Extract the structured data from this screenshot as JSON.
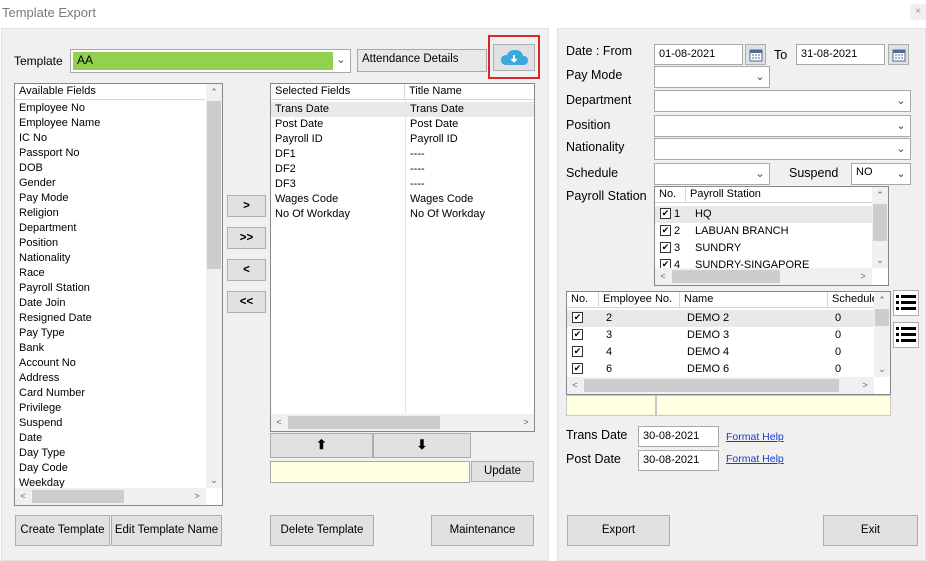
{
  "window": {
    "title": "Template Export",
    "close": "×"
  },
  "template": {
    "label": "Template",
    "value": "AA",
    "attendance_label": "Attendance Details",
    "download_icon": "cloud-download-icon",
    "accent": "#92d050"
  },
  "available": {
    "header": "Available Fields",
    "items": [
      "Employee No",
      "Employee Name",
      "IC No",
      "Passport No",
      "DOB",
      "Gender",
      "Pay Mode",
      "Religion",
      "Department",
      "Position",
      "Nationality",
      "Race",
      "Payroll Station",
      "Date Join",
      "Resigned Date",
      "Pay Type",
      "Bank",
      "Account No",
      "Address",
      "Card Number",
      "Privilege",
      "Suspend",
      "Date",
      "Day Type",
      "Day Code",
      "Weekday"
    ]
  },
  "move": {
    "add": ">",
    "add_all": ">>",
    "remove": "<",
    "remove_all": "<<"
  },
  "selected": {
    "headers": [
      "Selected Fields",
      "Title Name"
    ],
    "rows": [
      [
        "Trans Date",
        "Trans Date"
      ],
      [
        "Post Date",
        "Post Date"
      ],
      [
        "Payroll ID",
        "Payroll ID"
      ],
      [
        "DF1",
        "----"
      ],
      [
        "DF2",
        "----"
      ],
      [
        "DF3",
        "----"
      ],
      [
        "Wages Code",
        "Wages Code"
      ],
      [
        "No Of Workday",
        "No Of Workday"
      ]
    ],
    "up_icon": "arrow-up-icon",
    "down_icon": "arrow-down-icon",
    "update_label": "Update",
    "update_value": ""
  },
  "buttons": {
    "create": "Create Template",
    "edit": "Edit Template Name",
    "delete": "Delete Template",
    "maintenance": "Maintenance",
    "export": "Export",
    "exit": "Exit"
  },
  "filters": {
    "date_from_label": "Date : From",
    "date_from": "01-08-2021",
    "to_label": "To",
    "date_to": "31-08-2021",
    "paymode_label": "Pay Mode",
    "department_label": "Department",
    "position_label": "Position",
    "nationality_label": "Nationality",
    "schedule_label": "Schedule",
    "suspend_label": "Suspend",
    "suspend_value": "NO",
    "payroll_station_label": "Payroll Station"
  },
  "stations": {
    "headers": [
      "No.",
      "Payroll Station"
    ],
    "rows": [
      {
        "no": "1",
        "name": "HQ"
      },
      {
        "no": "2",
        "name": "LABUAN BRANCH"
      },
      {
        "no": "3",
        "name": "SUNDRY"
      },
      {
        "no": "4",
        "name": "SUNDRY-SINGAPORE"
      }
    ]
  },
  "employees": {
    "headers": [
      "No.",
      "Employee No.",
      "Name",
      "Schedule"
    ],
    "rows": [
      {
        "no": "2",
        "name": "DEMO 2",
        "sched": "0"
      },
      {
        "no": "3",
        "name": "DEMO 3",
        "sched": "0"
      },
      {
        "no": "4",
        "name": "DEMO 4",
        "sched": "0"
      },
      {
        "no": "6",
        "name": "DEMO 6",
        "sched": "0"
      }
    ]
  },
  "dates": {
    "trans_label": "Trans Date",
    "trans_value": "30-08-2021",
    "post_label": "Post Date",
    "post_value": "30-08-2021",
    "format_help": "Format Help"
  }
}
